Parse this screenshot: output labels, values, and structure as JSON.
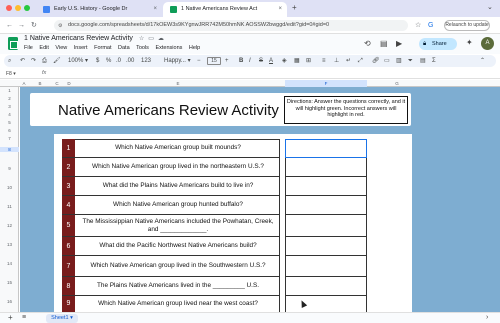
{
  "browser": {
    "tabs": [
      {
        "title": "Early U.S. History - Google Dr",
        "active": false
      },
      {
        "title": "1 Native Americans Review Act",
        "active": true
      }
    ],
    "new_tab_icon": "plus-icon",
    "url": "docs.google.com/spreadsheets/d/17kOEW3s9KYgnwJRR742M50hmNK AOSSW2bwggd/edit?gid=0#gid=0",
    "relaunch_label": "Relaunch to update"
  },
  "sheets": {
    "doc_title": "1 Native Americans Review Activity",
    "menu": [
      "File",
      "Edit",
      "View",
      "Insert",
      "Format",
      "Data",
      "Tools",
      "Extensions",
      "Help"
    ],
    "share_label": "Share",
    "avatar_letter": "A",
    "toolbar": {
      "zoom": "100%",
      "currency": "$",
      "percent": "%",
      "decimals": ".0",
      "decimals_more": ".00",
      "format_123": "123",
      "font": "Happy...",
      "font_size": "15",
      "bold": "B",
      "italic": "I",
      "strike": "S",
      "text_color": "A"
    },
    "cell_ref": "F8",
    "columns": [
      "A",
      "B",
      "C",
      "D",
      "E",
      "F",
      "G"
    ],
    "rows": [
      "1",
      "2",
      "3",
      "4",
      "5",
      "6",
      "7",
      "8",
      "9",
      "10",
      "11",
      "12",
      "13",
      "14",
      "15",
      "16"
    ],
    "sheet_tab": "Sheet1"
  },
  "activity": {
    "title": "Native Americans Review Activity",
    "directions": "Directions: Answer the questions correctly, and it will highlight green. Incorrect answers will highlight in red.",
    "questions": [
      {
        "num": "1",
        "text": "Which Native American group built mounds?"
      },
      {
        "num": "2",
        "text": "Which Native American group lived in the northeastern U.S.?"
      },
      {
        "num": "3",
        "text": "What did the Plains Native Americans build to live in?"
      },
      {
        "num": "4",
        "text": "Which Native American group hunted buffalo?"
      },
      {
        "num": "5",
        "text": "The Mississippian Native Americans included the Powhatan, Creek, and _____________."
      },
      {
        "num": "6",
        "text": "What did the Pacific Northwest Native Americans build?"
      },
      {
        "num": "7",
        "text": "Which Native American group lived in the Southwestern U.S.?"
      },
      {
        "num": "8",
        "text": "The Plains Native Americans lived in the _________ U.S."
      },
      {
        "num": "9",
        "text": "Which Native American group lived near the west coast?"
      }
    ]
  },
  "colors": {
    "sheet_bg": "#7eadd1",
    "number_cell": "#781c1c",
    "share_button": "#c2e7ff",
    "selection": "#1a73e8"
  }
}
